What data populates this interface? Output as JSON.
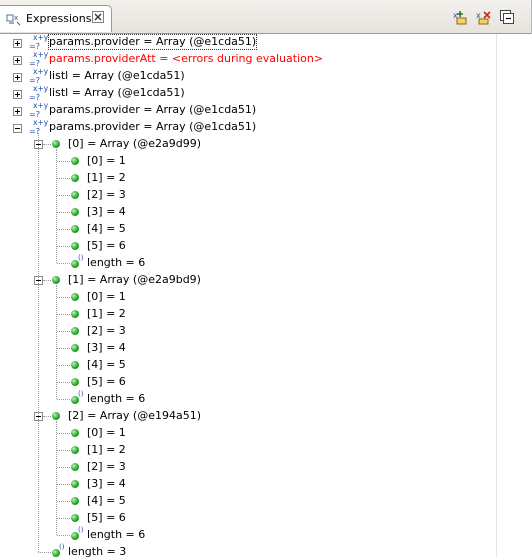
{
  "view": {
    "tab_title": "Expressions"
  },
  "icons": {
    "tab": "expressions-view-icon",
    "close": "close-icon",
    "toolbar": [
      "add-watch-expression-icon",
      "remove-expression-icon",
      "collapse-all-icon"
    ],
    "expression": "x-plus-y-icon",
    "variable": "green-dot-icon"
  },
  "expressions": [
    {
      "label": "params.provider = Array (@e1cda51)",
      "expanded": false,
      "selected": true
    },
    {
      "label": "params.providerAtt = <errors during evaluation>",
      "expanded": false,
      "error": true
    },
    {
      "label": "listl = Array (@e1cda51)",
      "expanded": false
    },
    {
      "label": "listl = Array (@e1cda51)",
      "expanded": false
    },
    {
      "label": "params.provider = Array (@e1cda51)",
      "expanded": false
    },
    {
      "label": "params.provider = Array (@e1cda51)",
      "expanded": true,
      "children": [
        {
          "label": "[0] = Array (@e2a9d99)",
          "items": [
            "[0] = 1",
            "[1] = 2",
            "[2] = 3",
            "[3] = 4",
            "[4] = 5",
            "[5] = 6"
          ],
          "length": "length = 6"
        },
        {
          "label": "[1] = Array (@e2a9bd9)",
          "items": [
            "[0] = 1",
            "[1] = 2",
            "[2] = 3",
            "[3] = 4",
            "[4] = 5",
            "[5] = 6"
          ],
          "length": "length = 6"
        },
        {
          "label": "[2] = Array (@e194a51)",
          "items": [
            "[0] = 1",
            "[1] = 2",
            "[2] = 3",
            "[3] = 4",
            "[4] = 5",
            "[5] = 6"
          ],
          "length": "length = 6"
        }
      ],
      "length": "length = 3"
    }
  ]
}
